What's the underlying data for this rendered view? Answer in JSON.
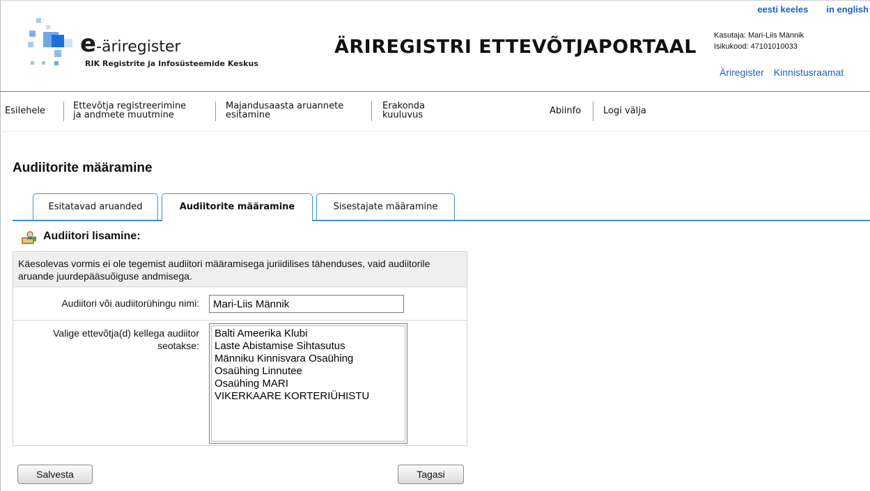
{
  "header": {
    "logo_e": "e",
    "logo_name": "-äriregister",
    "logo_subtitle": "RIK Registrite ja Infosüsteemide Keskus",
    "portal_title": "ÄRIREGISTRI ETTEVÕTJAPORTAAL",
    "lang_links": [
      "eesti keeles",
      "in english"
    ],
    "user_label": "Kasutaja:",
    "user_name": "Mari-Liis Männik",
    "id_label": "Isikukood:",
    "id_code": "47101010033",
    "ext_links": [
      "Äriregister",
      "Kinnistusraamat"
    ]
  },
  "nav": {
    "items": [
      {
        "line1": "Esilehele",
        "line2": ""
      },
      {
        "line1": "Ettevõtja registreerimine",
        "line2": "ja andmete muutmine"
      },
      {
        "line1": "Majandusaasta aruannete",
        "line2": "esitamine"
      },
      {
        "line1": "Erakonda",
        "line2": "kuuluvus"
      },
      {
        "line1": "Abiinfo",
        "line2": ""
      },
      {
        "line1": "Logi välja",
        "line2": ""
      }
    ]
  },
  "page": {
    "title": "Audiitorite määramine"
  },
  "tabs": [
    {
      "label": "Esitatavad aruanded"
    },
    {
      "label": "Audiitorite määramine"
    },
    {
      "label": "Sisestajate määramine"
    }
  ],
  "section": {
    "title": "Audiitori lisamine:",
    "icon": "auditor-icon"
  },
  "form": {
    "notice": "Käesolevas vormis ei ole tegemist audiitori määramisega juriidilises tähenduses, vaid audiitorile aruande juurdepääsuõiguse andmisega.",
    "name_label": "Audiitori või audiitorühingu nimi:",
    "name_value": "Mari-Liis Männik",
    "companies_label_line1": "Valige ettevõtja(d) kellega audiitor",
    "companies_label_line2": "seotakse:",
    "companies": [
      "Balti Ameerika Klubi",
      "Laste Abistamise Sihtasutus",
      "Männiku Kinnisvara Osaühing",
      "Osaühing Linnutee",
      "Osaühing MARI",
      "VIKERKAARE KORTERIÜHISTU"
    ]
  },
  "buttons": {
    "save": "Salvesta",
    "back": "Tagasi"
  },
  "colors": {
    "accent_blue": "#3f8fd6",
    "link_blue": "#1a62c9"
  }
}
